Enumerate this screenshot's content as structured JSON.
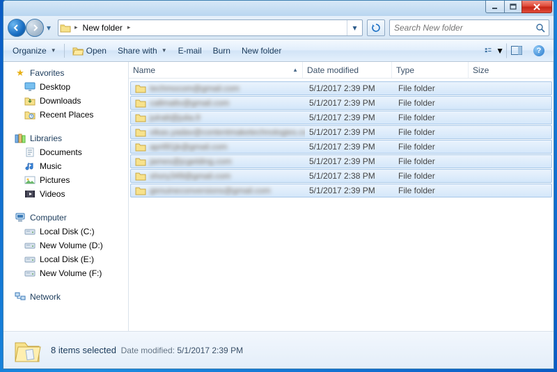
{
  "breadcrumb": {
    "location": "New folder",
    "arrow": "▸"
  },
  "search": {
    "placeholder": "Search New folder"
  },
  "toolbar": {
    "organize": "Organize",
    "open": "Open",
    "share": "Share with",
    "email": "E-mail",
    "burn": "Burn",
    "newfolder": "New folder"
  },
  "columns": {
    "name": "Name",
    "date": "Date modified",
    "type": "Type",
    "size": "Size"
  },
  "sidebar": {
    "favorites": {
      "label": "Favorites",
      "items": [
        {
          "label": "Desktop",
          "icon": "desktop"
        },
        {
          "label": "Downloads",
          "icon": "downloads"
        },
        {
          "label": "Recent Places",
          "icon": "recent"
        }
      ]
    },
    "libraries": {
      "label": "Libraries",
      "items": [
        {
          "label": "Documents",
          "icon": "documents"
        },
        {
          "label": "Music",
          "icon": "music"
        },
        {
          "label": "Pictures",
          "icon": "pictures"
        },
        {
          "label": "Videos",
          "icon": "videos"
        }
      ]
    },
    "computer": {
      "label": "Computer",
      "items": [
        {
          "label": "Local Disk (C:)",
          "icon": "drive"
        },
        {
          "label": "New Volume (D:)",
          "icon": "drive"
        },
        {
          "label": "Local Disk (E:)",
          "icon": "drive"
        },
        {
          "label": "New Volume (F:)",
          "icon": "drive"
        }
      ]
    },
    "network": {
      "label": "Network"
    }
  },
  "files": [
    {
      "name": "techmocom@gmail.com",
      "date": "5/1/2017 2:39 PM",
      "type": "File folder"
    },
    {
      "name": "callmattv@gmail.com",
      "date": "5/1/2017 2:39 PM",
      "type": "File folder"
    },
    {
      "name": "julratt@julia.fr",
      "date": "5/1/2017 2:39 PM",
      "type": "File folder"
    },
    {
      "name": "vikas.yadav@contentmaketechnologies.com",
      "date": "5/1/2017 2:39 PM",
      "type": "File folder"
    },
    {
      "name": "april91jk@gmail.com",
      "date": "5/1/2017 2:39 PM",
      "type": "File folder"
    },
    {
      "name": "james@jcgelding.com",
      "date": "5/1/2017 2:39 PM",
      "type": "File folder"
    },
    {
      "name": "shory349@gmail.com",
      "date": "5/1/2017 2:38 PM",
      "type": "File folder"
    },
    {
      "name": "genuineconversions@gmail.com",
      "date": "5/1/2017 2:39 PM",
      "type": "File folder"
    }
  ],
  "details": {
    "title": "8 items selected",
    "date_label": "Date modified:",
    "date_value": "5/1/2017 2:39 PM"
  }
}
